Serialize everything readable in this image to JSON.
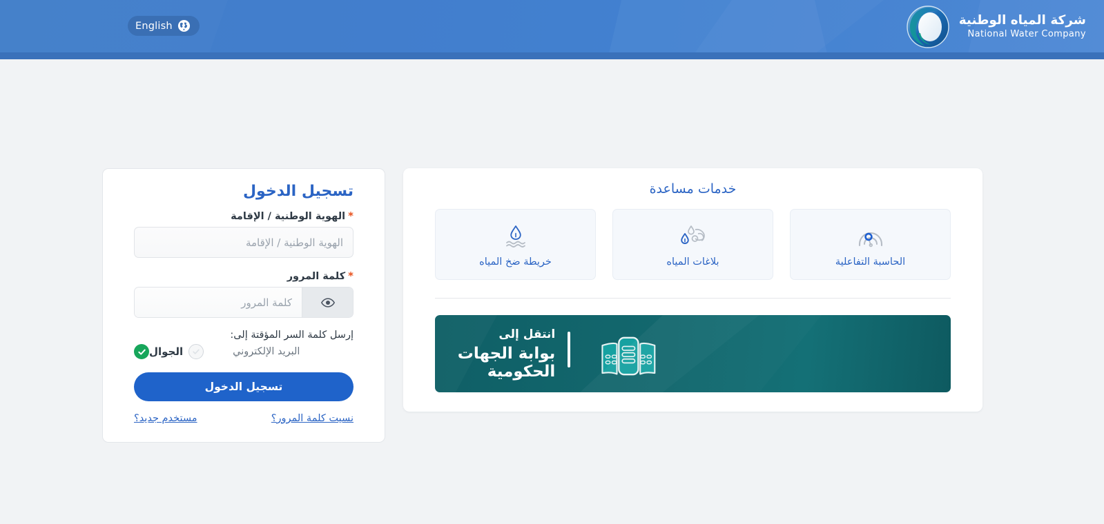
{
  "header": {
    "lang_button_label": "English",
    "lang_button_icon": "globe-icon",
    "brand_name_ar": "شركة المياه الوطنية",
    "brand_name_en": "National Water Company",
    "brand_logo_icon": "nwc-logo-icon",
    "bg_color": "#3f7dc9",
    "strip_color": "#3a71ba"
  },
  "login": {
    "title": "تسجيل الدخول",
    "id_label": "الهوية الوطنية / الإقامة",
    "id_required_mark": "*",
    "id_placeholder": "الهوية الوطنية / الإقامة",
    "id_value": "",
    "password_label": "كلمة المرور",
    "password_required_mark": "*",
    "password_placeholder": "كلمة المرور",
    "password_value": "",
    "password_toggle_icon": "eye-icon",
    "otp_label": "إرسل كلمة السر المؤقتة إلى:",
    "otp_option_mobile": "الجوال",
    "otp_option_email": "البريد الإلكتروني",
    "otp_selected": "الجوال",
    "submit_label": "تسجيل الدخول",
    "new_user_link": "مستخدم جديد؟",
    "forgot_password_link": "نسيت كلمة المرور؟",
    "title_color": "#2b64c4",
    "submit_color": "#1f63ca",
    "selected_color": "#17a65b",
    "required_color": "#e8521f"
  },
  "services": {
    "title": "خدمات مساعدة",
    "tiles": [
      {
        "label": "خريطة ضخ المياه",
        "icon": "water-pump-map-icon"
      },
      {
        "label": "بلاغات المياه",
        "icon": "water-reports-icon"
      },
      {
        "label": "الحاسبة التفاعلية",
        "icon": "interactive-calculator-icon"
      }
    ],
    "tile_label_color": "#2b64c4"
  },
  "gov_banner": {
    "line1": "انتقل إلى",
    "line2": "بوابة الجهات الحكومية",
    "icon": "government-buildings-icon",
    "bg_color": "#13686e"
  }
}
